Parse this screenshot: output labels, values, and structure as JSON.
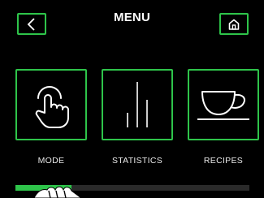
{
  "header": {
    "title": "MENU",
    "back_icon": "chevron-left-icon",
    "home_icon": "home-icon"
  },
  "tiles": [
    {
      "label": "MODE",
      "icon": "touch-hand-icon"
    },
    {
      "label": "STATISTICS",
      "icon": "bar-lines-icon"
    },
    {
      "label": "RECIPES",
      "icon": "coffee-cup-icon"
    }
  ],
  "pager": {
    "progress": 0.24
  },
  "colors": {
    "accent": "#2ec44a",
    "background": "#000000",
    "text": "#ffffff"
  }
}
